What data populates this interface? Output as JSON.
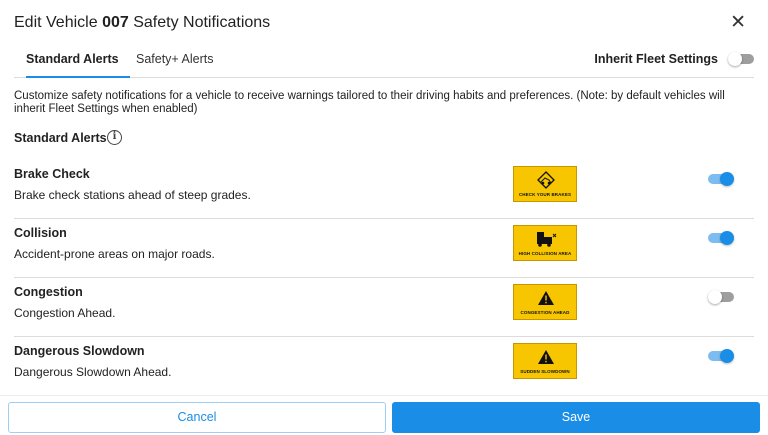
{
  "modal": {
    "title_prefix": "Edit Vehicle ",
    "title_vehicle": "007",
    "title_suffix": " Safety Notifications",
    "close_glyph": "✕"
  },
  "tabs": [
    {
      "label": "Standard Alerts",
      "active": true
    },
    {
      "label": "Safety+ Alerts",
      "active": false
    }
  ],
  "inherit": {
    "label": "Inherit Fleet Settings",
    "enabled": false
  },
  "description": "Customize safety notifications for a vehicle to receive warnings tailored to their driving habits and preferences. (Note: by default vehicles will inherit Fleet Settings when enabled)",
  "section": {
    "title": "Standard Alerts",
    "info_glyph": "i"
  },
  "alerts": [
    {
      "name": "Brake Check",
      "description": "Brake check stations ahead of steep grades.",
      "sign_text": "CHECK YOUR BRAKES",
      "sign_icon": "brake-check-icon",
      "enabled": true
    },
    {
      "name": "Collision",
      "description": "Accident-prone areas on major roads.",
      "sign_text": "HIGH COLLISION AREA",
      "sign_icon": "collision-icon",
      "enabled": true
    },
    {
      "name": "Congestion",
      "description": "Congestion Ahead.",
      "sign_text": "CONGESTION AHEAD",
      "sign_icon": "warning-triangle-icon",
      "enabled": false
    },
    {
      "name": "Dangerous Slowdown",
      "description": "Dangerous Slowdown Ahead.",
      "sign_text": "SUDDEN SLOWDOWN",
      "sign_icon": "warning-triangle-icon",
      "enabled": true
    }
  ],
  "footer": {
    "cancel_label": "Cancel",
    "save_label": "Save"
  },
  "colors": {
    "accent": "#1a8ee6",
    "sign_yellow": "#f7c600",
    "toggle_on_track": "#7cbcf0",
    "toggle_off_track": "#9e9e9e"
  }
}
